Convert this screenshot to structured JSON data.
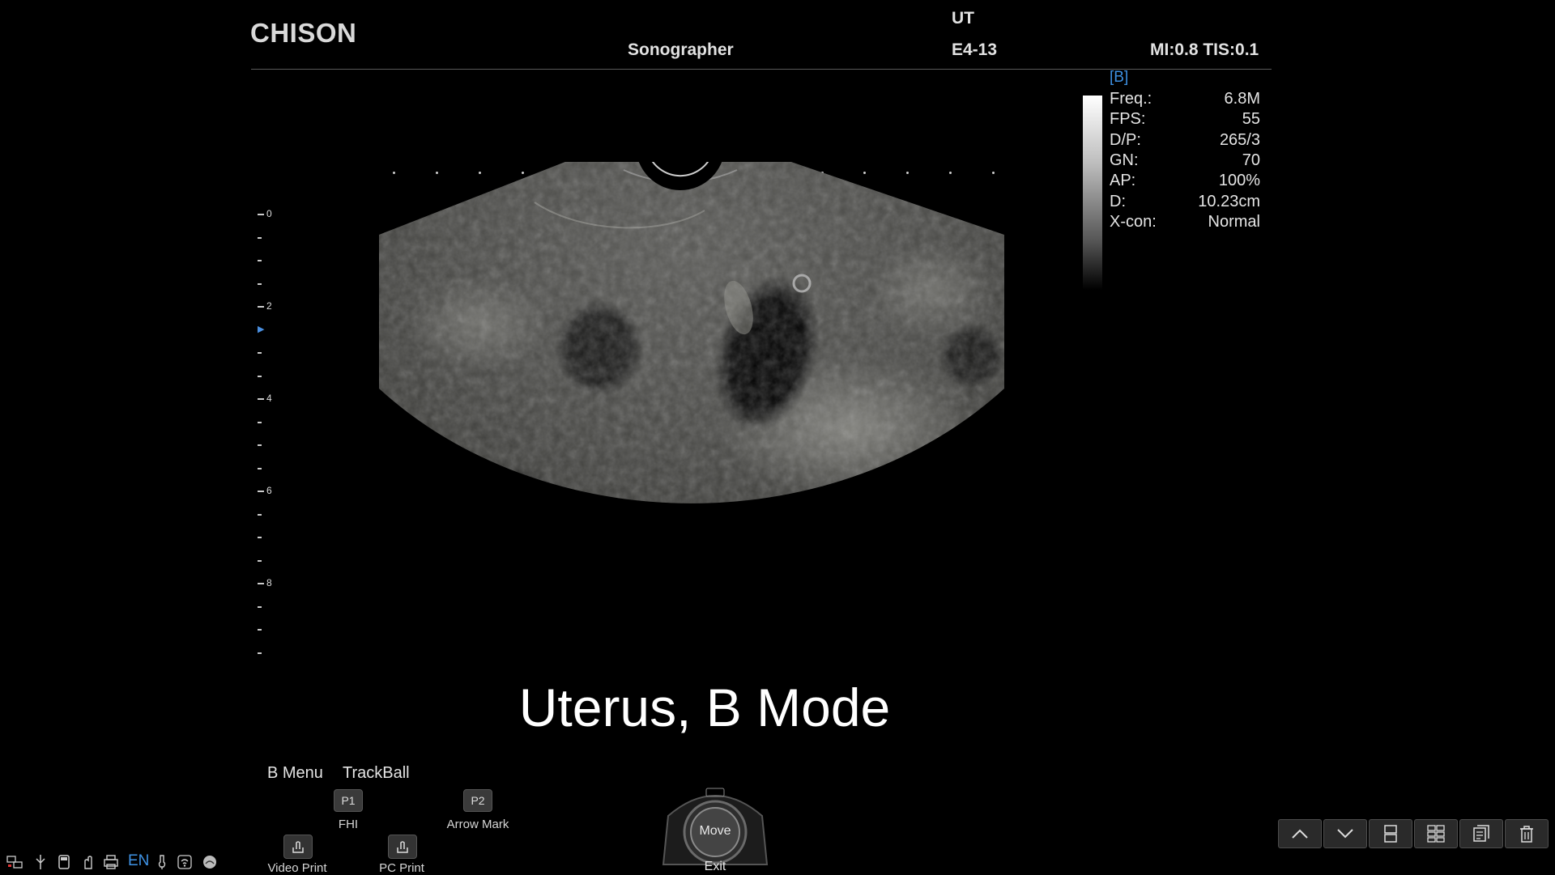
{
  "header": {
    "brand": "CHISON",
    "operator": "Sonographer",
    "exam": "UT",
    "probe": "E4-13",
    "safety_index": "MI:0.8 TIS:0.1"
  },
  "params": {
    "mode_tag": "[B]",
    "rows": [
      {
        "k": "Freq.:",
        "v": "6.8M"
      },
      {
        "k": "FPS:",
        "v": "55"
      },
      {
        "k": "D/P:",
        "v": "265/3"
      },
      {
        "k": "GN:",
        "v": "70"
      },
      {
        "k": "AP:",
        "v": "100%"
      },
      {
        "k": "D:",
        "v": "10.23cm"
      },
      {
        "k": "X-con:",
        "v": "Normal"
      }
    ]
  },
  "depth_scale": {
    "labels": [
      "0",
      "2",
      "4",
      "6",
      "8"
    ],
    "unit_max": 9.5,
    "focus_depth": 2.5
  },
  "orientation_mark": "C",
  "caption": "Uterus, B Mode",
  "bottom_menu": {
    "b_menu": "B Menu",
    "trackball": "TrackBall",
    "p1_key": "P1",
    "p1_label": "FHI",
    "p2_key": "P2",
    "p2_label": "Arrow Mark",
    "video_print": "Video Print",
    "pc_print": "PC Print"
  },
  "trackball_control": {
    "center": "Move",
    "bottom": "Exit"
  },
  "system_tray": {
    "language": "EN",
    "icons": [
      "network-icon",
      "usb-icon",
      "disk-icon",
      "hand-icon",
      "printer-icon",
      "language-indicator",
      "probe-icon",
      "wifi-icon",
      "speaker-icon"
    ]
  },
  "right_toolbar": {
    "icons": [
      "chevron-up-icon",
      "chevron-down-icon",
      "layout-split-icon",
      "layout-grid-icon",
      "report-icon",
      "delete-icon"
    ]
  },
  "colors": {
    "accent": "#3d8fe0",
    "background": "#000000",
    "text": "#e4e4e4"
  }
}
